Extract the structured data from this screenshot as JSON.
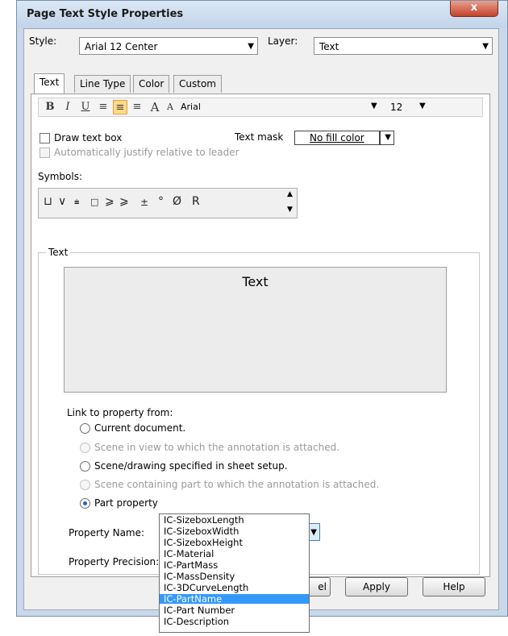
{
  "window": {
    "title": "Page Text Style Properties",
    "close_glyph": "x"
  },
  "style_row": {
    "label": "Style:",
    "value": "Arial 12 Center",
    "layer_label": "Layer:",
    "layer_value": "Text"
  },
  "tabs": [
    {
      "label": "Text",
      "active": true
    },
    {
      "label": "Line Type",
      "active": false
    },
    {
      "label": "Color",
      "active": false
    },
    {
      "label": "Custom",
      "active": false
    }
  ],
  "toolbar": {
    "bold": "B",
    "italic": "I",
    "underline": "U",
    "align_left": "≡",
    "align_center": "≡",
    "align_right": "≡",
    "font_larger": "A",
    "font_smaller": "A",
    "font_name": "Arial",
    "font_size": "12",
    "selected_accent": "#ffd98a"
  },
  "options": {
    "draw_text_box": "Draw text box",
    "auto_justify": "Automatically justify relative to leader",
    "text_mask_label": "Text mask",
    "text_mask_value": "No fill color"
  },
  "symbols": {
    "label": "Symbols:",
    "items": [
      "⊔",
      "∨",
      "⩧",
      "□",
      "⩾",
      "⩾",
      "±",
      "°",
      "Ø",
      "R"
    ]
  },
  "text_group": {
    "legend": "Text",
    "preview": "Text"
  },
  "link": {
    "label": "Link to property from:",
    "options": [
      {
        "label": "Current document.",
        "enabled": true,
        "checked": false
      },
      {
        "label": "Scene in view to which the annotation is attached.",
        "enabled": false,
        "checked": false
      },
      {
        "label": "Scene/drawing specified in sheet setup.",
        "enabled": true,
        "checked": false
      },
      {
        "label": "Scene containing part to which the annotation is attached.",
        "enabled": false,
        "checked": false
      },
      {
        "label": "Part property",
        "enabled": true,
        "checked": true
      }
    ]
  },
  "property": {
    "name_label": "Property Name:",
    "name_value": "",
    "precision_label": "Property Precision:",
    "dropdown_items": [
      "IC-SizeboxLength",
      "IC-SizeboxWidth",
      "IC-SizeboxHeight",
      "IC-Material",
      "IC-PartMass",
      "IC-MassDensity",
      "IC-3DCurveLength",
      "IC-PartName",
      "IC-Part Number",
      "IC-Description"
    ],
    "selected_item": "IC-PartName",
    "highlight_color": "#3399ff"
  },
  "buttons": {
    "cancel_partial": "el",
    "apply": "Apply",
    "help": "Help"
  }
}
